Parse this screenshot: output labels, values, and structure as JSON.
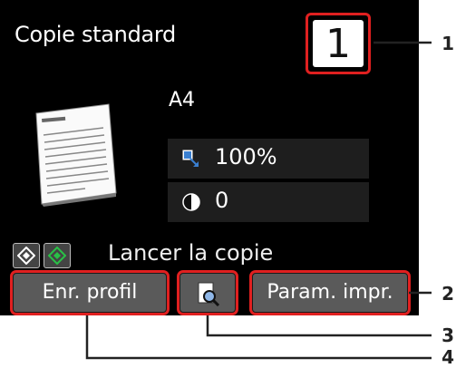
{
  "screen": {
    "mode_title": "Copie standard",
    "copies": "1",
    "paper_size": "A4",
    "magnification": "100%",
    "intensity": "0",
    "start_label": "Lancer la copie"
  },
  "buttons": {
    "save_profile": "Enr. profil",
    "print_settings": "Param. impr."
  },
  "callouts": [
    "1",
    "2",
    "3",
    "4"
  ],
  "colors": {
    "highlight": "#e02020",
    "screen_bg": "#000000",
    "button_bg": "#5a5a5a",
    "start_color_icon": "#29c046"
  }
}
